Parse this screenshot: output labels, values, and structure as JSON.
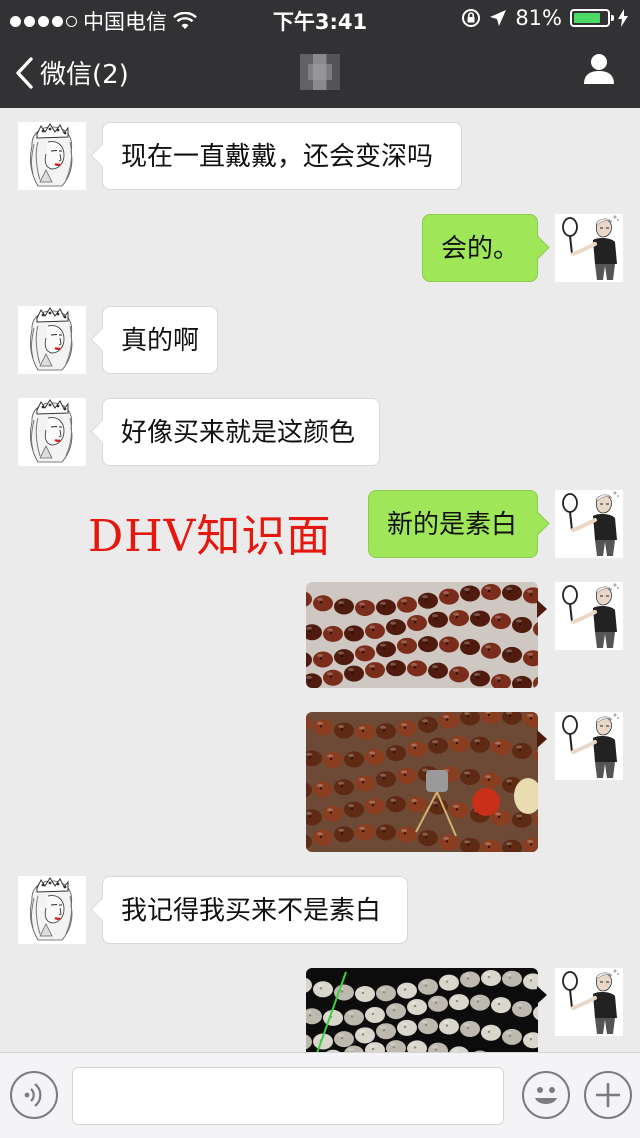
{
  "status_bar": {
    "carrier": "中国电信",
    "time": "下午3:41",
    "battery": "81%",
    "battery_level": 0.81,
    "signal_bars_filled": 4,
    "signal_bars_total": 5
  },
  "nav": {
    "back_label": "微信(2)",
    "title": "",
    "back_icon": "chevron-left-icon",
    "profile_icon": "person-icon"
  },
  "messages": [
    {
      "side": "in",
      "text": "现在一直戴戴，还会变深吗"
    },
    {
      "side": "out",
      "text": "会的。"
    },
    {
      "side": "in",
      "text": "真的啊"
    },
    {
      "side": "in",
      "text": "好像买来就是这颜色"
    },
    {
      "side": "out",
      "text": "新的是素白"
    },
    {
      "side": "out",
      "type": "image",
      "content": "dark red-brown bodhi bead bracelets"
    },
    {
      "side": "out",
      "type": "image",
      "content": "red-brown bead bracelet with tassel"
    },
    {
      "side": "in",
      "text": "我记得我买来不是素白"
    },
    {
      "side": "out",
      "type": "image",
      "content": "white bodhi bead bracelets"
    }
  ],
  "watermark": "DHV知识面",
  "input_bar": {
    "voice_icon": "voice-icon",
    "emoji_icon": "emoji-icon",
    "plus_icon": "plus-icon"
  },
  "colors": {
    "header_bg": "#323234",
    "chat_bg": "#ebebeb",
    "out_bubble": "#9fe659",
    "in_bubble": "#ffffff",
    "watermark": "#e5180f",
    "battery_fill": "#4cd964"
  }
}
